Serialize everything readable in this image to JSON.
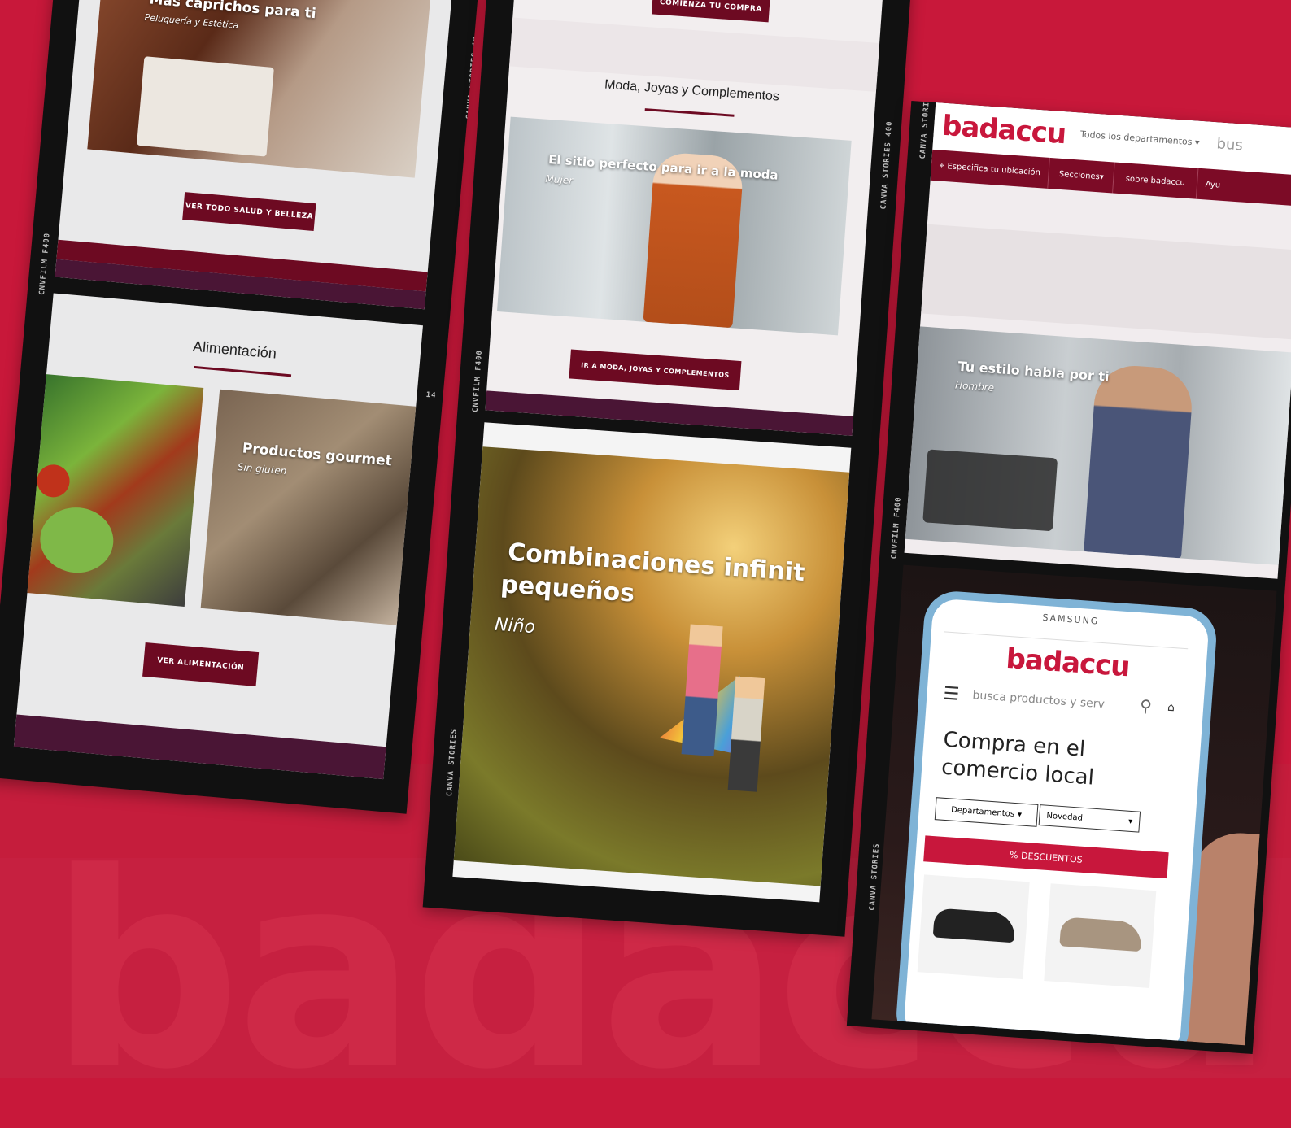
{
  "watermark": "badaccu",
  "film_labels": {
    "f1_top": "CANVA STORIES 40",
    "f1_side": "CNVFILM F400",
    "f1_num": "14",
    "f2_side1": "CANVA STORIES 400",
    "f2_side2": "CNVFILM F400",
    "f2_bottom": "CANVA STORIES",
    "f3_side1": "CANVA STORI",
    "f3_side2": "CNVFILM F400",
    "f3_bottom": "CANVA STORIES"
  },
  "frame1": {
    "beauty": {
      "title": "Más caprichos para ti",
      "subtitle": "Peluquería y Estética",
      "button": "VER TODO SALUD Y BELLEZA"
    },
    "food": {
      "section_title": "Alimentación",
      "card2_title": "Productos gourmet",
      "card2_subtitle": "Sin gluten",
      "button": "VER ALIMENTACIÓN"
    }
  },
  "frame2": {
    "top_button": "COMIENZA TU COMPRA",
    "section_title": "Moda, Joyas y Complementos",
    "hero_title": "El sitio perfecto para ir a la moda",
    "hero_subtitle": "Mujer",
    "button": "IR A MODA, JOYAS Y COMPLEMENTOS",
    "kids_title_line1": "Combinaciones infinit",
    "kids_title_line2": "pequeños",
    "kids_subtitle": "Niño"
  },
  "frame3": {
    "logo": "badaccu",
    "departments": "Todos los departamentos",
    "search_partial": "bus",
    "location": "Especifica tu ubicación",
    "nav": [
      "Secciones",
      "sobre badaccu",
      "Ayu"
    ],
    "hero_title": "Tu estilo habla por ti",
    "hero_subtitle": "Hombre",
    "phone": {
      "brand": "SAMSUNG",
      "logo": "badaccu",
      "search_placeholder": "busca productos y serv",
      "headline_line1": "Compra en el",
      "headline_line2": "comercio local",
      "departments_select": "Departamentos",
      "sort_select": "Novedad",
      "discount_bar": "% DESCUENTOS"
    }
  },
  "colors": {
    "background": "#c8183a",
    "maroon": "#6d0a22",
    "brand_red": "#c8173c"
  }
}
